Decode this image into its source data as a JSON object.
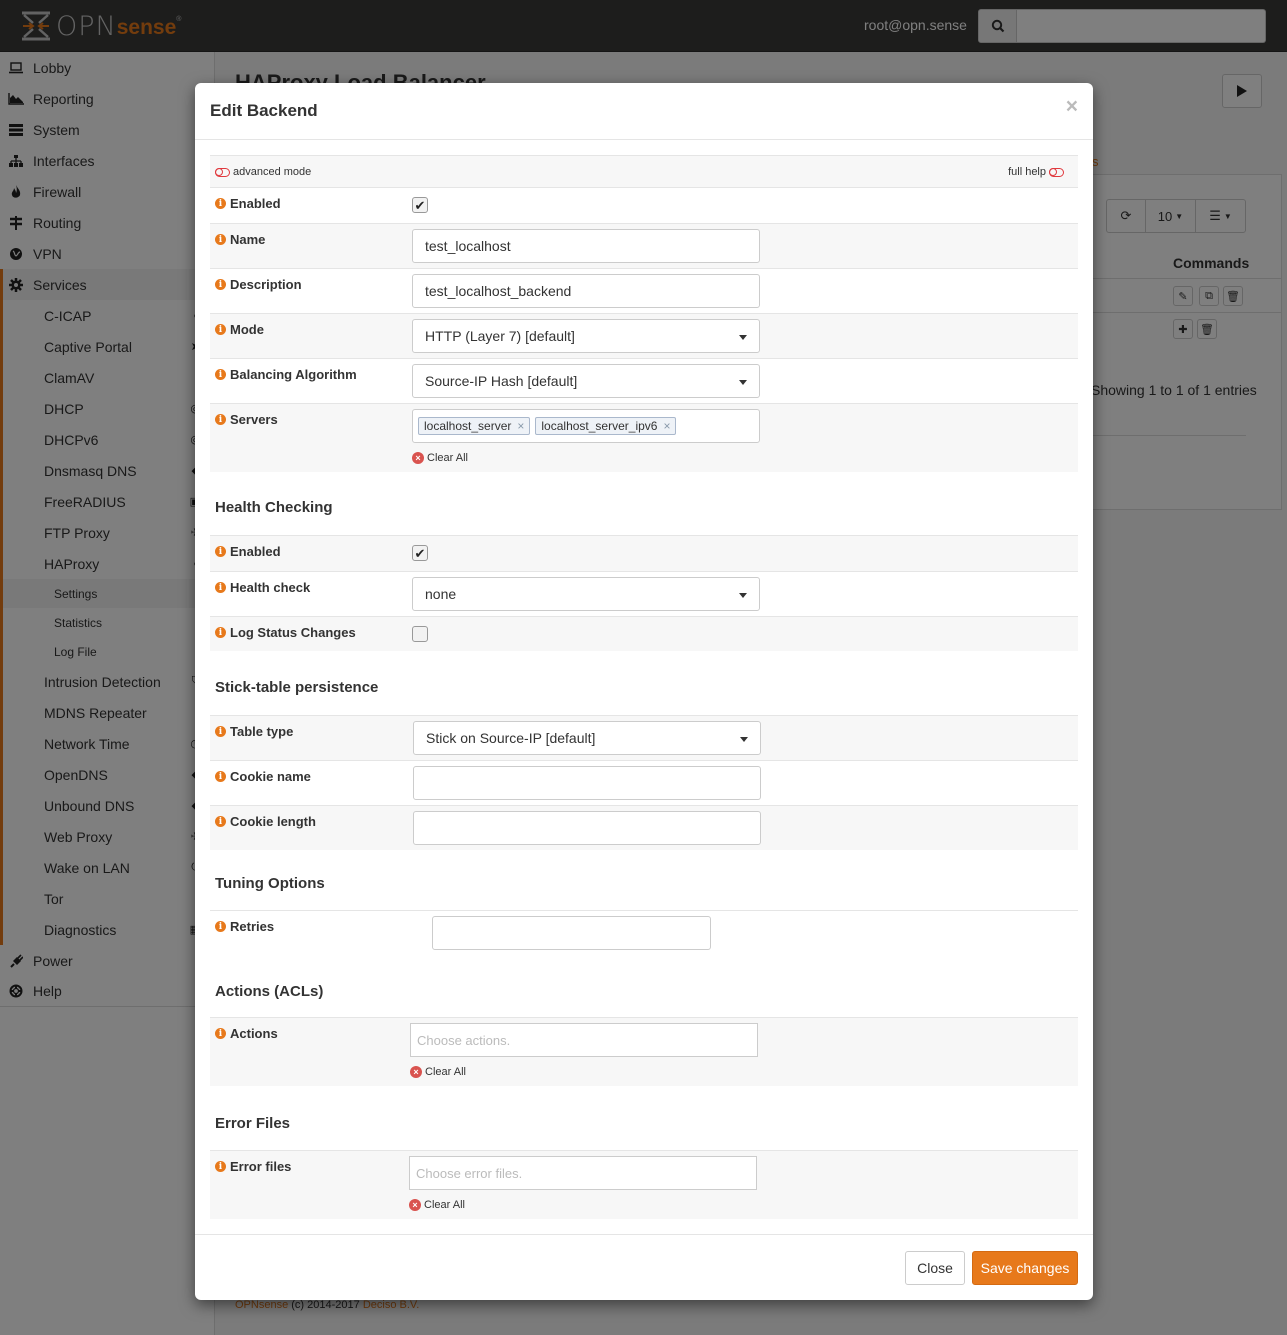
{
  "topbar": {
    "logo_opn": "OPN",
    "logo_sense": "sense",
    "logo_reg": "®",
    "user": "root@opn.sense",
    "search_placeholder": "",
    "search_icon": "search-icon"
  },
  "sidebar": {
    "items": [
      {
        "label": "Lobby",
        "icon": "laptop-icon"
      },
      {
        "label": "Reporting",
        "icon": "area-chart-icon"
      },
      {
        "label": "System",
        "icon": "server-icon"
      },
      {
        "label": "Interfaces",
        "icon": "sitemap-icon"
      },
      {
        "label": "Firewall",
        "icon": "fire-icon"
      },
      {
        "label": "Routing",
        "icon": "signpost-icon"
      },
      {
        "label": "VPN",
        "icon": "globe-icon"
      },
      {
        "label": "Services",
        "icon": "gear-icon"
      }
    ],
    "services_sub": [
      {
        "label": "C-ICAP"
      },
      {
        "label": "Captive Portal"
      },
      {
        "label": "ClamAV"
      },
      {
        "label": "DHCP"
      },
      {
        "label": "DHCPv6"
      },
      {
        "label": "Dnsmasq DNS"
      },
      {
        "label": "FreeRADIUS"
      },
      {
        "label": "FTP Proxy"
      },
      {
        "label": "HAProxy"
      }
    ],
    "haproxy_sub": [
      {
        "label": "Settings"
      },
      {
        "label": "Statistics"
      },
      {
        "label": "Log File"
      }
    ],
    "services_sub2": [
      {
        "label": "Intrusion Detection"
      },
      {
        "label": "MDNS Repeater"
      },
      {
        "label": "Network Time"
      },
      {
        "label": "OpenDNS"
      },
      {
        "label": "Unbound DNS"
      },
      {
        "label": "Web Proxy"
      },
      {
        "label": "Wake on LAN"
      },
      {
        "label": "Tor"
      },
      {
        "label": "Diagnostics"
      }
    ],
    "bottom_items": [
      {
        "label": "Power",
        "icon": "plug-icon"
      },
      {
        "label": "Help",
        "icon": "lifebuoy-icon"
      }
    ]
  },
  "page": {
    "title": "HAProxy Load Balancer",
    "tab_link_fragment": "s",
    "grid": {
      "page_size": "10",
      "commands_header": "Commands",
      "showing": "Showing 1 to 1 of 1 entries"
    },
    "footer": {
      "brand": "OPNsense",
      "copyright": "(c) 2014-2017",
      "company": "Deciso B.V."
    }
  },
  "modal": {
    "title": "Edit Backend",
    "close_x": "×",
    "advanced_mode": "advanced mode",
    "full_help": "full help",
    "fields": {
      "enabled": {
        "label": "Enabled",
        "checked": true
      },
      "name": {
        "label": "Name",
        "value": "test_localhost"
      },
      "description": {
        "label": "Description",
        "value": "test_localhost_backend"
      },
      "mode": {
        "label": "Mode",
        "value": "HTTP (Layer 7) [default]"
      },
      "balancing": {
        "label": "Balancing Algorithm",
        "value": "Source-IP Hash [default]"
      },
      "servers": {
        "label": "Servers",
        "tags": [
          "localhost_server",
          "localhost_server_ipv6"
        ],
        "clear_all": "Clear All"
      }
    },
    "health": {
      "title": "Health Checking",
      "enabled": {
        "label": "Enabled",
        "checked": true
      },
      "health_check": {
        "label": "Health check",
        "value": "none"
      },
      "log_status": {
        "label": "Log Status Changes",
        "checked": false
      }
    },
    "stick": {
      "title": "Stick-table persistence",
      "table_type": {
        "label": "Table type",
        "value": "Stick on Source-IP [default]"
      },
      "cookie_name": {
        "label": "Cookie name",
        "value": ""
      },
      "cookie_length": {
        "label": "Cookie length",
        "value": ""
      }
    },
    "tuning": {
      "title": "Tuning Options",
      "retries": {
        "label": "Retries",
        "value": ""
      }
    },
    "actions": {
      "title": "Actions (ACLs)",
      "actions": {
        "label": "Actions",
        "placeholder": "Choose actions.",
        "clear_all": "Clear All"
      }
    },
    "errorfiles": {
      "title": "Error Files",
      "error_files": {
        "label": "Error files",
        "placeholder": "Choose error files.",
        "clear_all": "Clear All"
      }
    },
    "footer": {
      "close": "Close",
      "save": "Save changes"
    }
  },
  "colors": {
    "accent": "#e7791b",
    "topbar": "#3a3a38",
    "danger": "#d9534f"
  }
}
